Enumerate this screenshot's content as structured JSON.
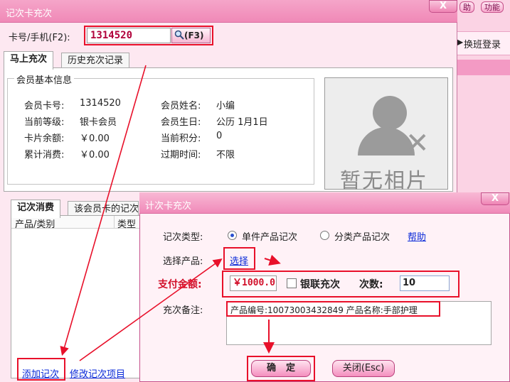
{
  "main": {
    "title": "记次卡充次",
    "close": "X",
    "card_label": "卡号/手机(F2):",
    "card_value": "1314520",
    "search_btn": "(F3)",
    "tabs": [
      {
        "label": "马上充次"
      },
      {
        "label": "历史充次记录"
      }
    ],
    "member_group_title": "会员基本信息",
    "info": [
      {
        "label": "会员卡号:",
        "value": "1314520"
      },
      {
        "label": "当前等级:",
        "value": "银卡会员"
      },
      {
        "label": "卡片余额:",
        "value": "￥0.00"
      },
      {
        "label": "累计消费:",
        "value": "￥0.00"
      },
      {
        "label": "会员姓名:",
        "value": "小编"
      },
      {
        "label": "会员生日:",
        "value": "公历 1月1日"
      },
      {
        "label": "当前积分:",
        "value": "0"
      },
      {
        "label": "过期时间:",
        "value": "不限"
      }
    ],
    "photo_text": "暂无相片",
    "lower_tabs": [
      {
        "label": "记次消费"
      },
      {
        "label": "该会员卡的记次"
      }
    ],
    "columns": [
      "产品/类别",
      "类型"
    ],
    "add_link": "添加记次",
    "edit_link": "修改记次项目"
  },
  "inner": {
    "title": "计次卡充次",
    "close": "X",
    "type_label": "记次类型:",
    "radio_single": "单件产品记次",
    "radio_category": "分类产品记次",
    "help_link": "帮助",
    "select_label": "选择产品:",
    "select_link": "选择",
    "amount_label": "支付金额:",
    "amount_value": "￥1000.0",
    "unionpay_label": "银联充次",
    "times_label": "次数:",
    "times_value": "10",
    "note_label": "充次备注:",
    "note_text": "产品编号:10073003432849 产品名称:手部护理",
    "ok_btn": "确定",
    "close_btn": "关闭(Esc)"
  },
  "background": {
    "help_btn": "助",
    "func_btn": "功能",
    "shift_login": "换班登录",
    "shift_arrow": "▶"
  },
  "colors": {
    "highlight": "#e8102a",
    "title_pink": "#f089b7",
    "link_blue": "#0a2ad8"
  }
}
